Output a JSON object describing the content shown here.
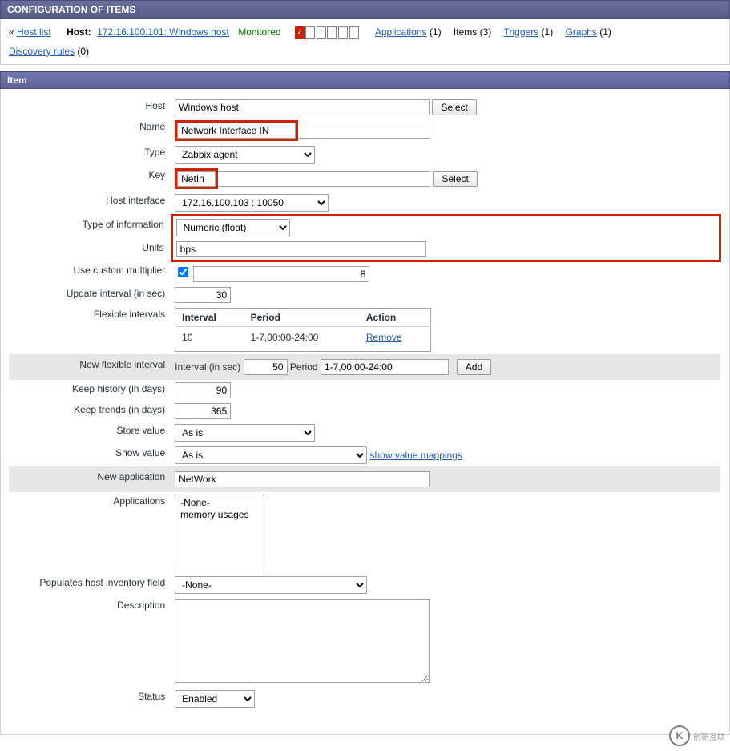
{
  "header": {
    "title": "CONFIGURATION OF ITEMS"
  },
  "nav": {
    "back_arrow": "«",
    "host_list": "Host list",
    "host_label": "Host:",
    "host_link": "172.16.100.101: Windows host",
    "monitored": "Monitored",
    "tags_letters": [
      "Z",
      "",
      "",
      "",
      "",
      ""
    ],
    "applications": {
      "label": "Applications",
      "count": "(1)"
    },
    "items": {
      "label": "Items",
      "count": "(3)"
    },
    "triggers": {
      "label": "Triggers",
      "count": "(1)"
    },
    "graphs": {
      "label": "Graphs",
      "count": "(1)"
    },
    "discovery": {
      "label": "Discovery rules",
      "count": "(0)"
    }
  },
  "section": {
    "title": "Item"
  },
  "form": {
    "labels": {
      "host": "Host",
      "name": "Name",
      "type": "Type",
      "key": "Key",
      "host_interface": "Host interface",
      "type_of_information": "Type of information",
      "units": "Units",
      "use_custom_multiplier": "Use custom multiplier",
      "update_interval": "Update interval (in sec)",
      "flexible_intervals": "Flexible intervals",
      "new_flexible_interval": "New flexible interval",
      "keep_history": "Keep history (in days)",
      "keep_trends": "Keep trends (in days)",
      "store_value": "Store value",
      "show_value": "Show value",
      "new_application": "New application",
      "applications": "Applications",
      "populates_inventory": "Populates host inventory field",
      "description": "Description",
      "status": "Status"
    },
    "values": {
      "host": "Windows host",
      "name": "Network Interface IN",
      "type": "Zabbix agent",
      "key": "NetIn",
      "host_interface": "172.16.100.103 : 10050",
      "type_of_information": "Numeric (float)",
      "units": "bps",
      "use_custom_multiplier_checked": true,
      "multiplier_value": "8",
      "update_interval": "30",
      "keep_history": "90",
      "keep_trends": "365",
      "store_value": "As is",
      "show_value": "As is",
      "new_application": "NetWork",
      "applications_options": [
        "-None-",
        "memory usages"
      ],
      "populates_inventory": "-None-",
      "description": "",
      "status": "Enabled"
    },
    "flex_table": {
      "headers": {
        "interval": "Interval",
        "period": "Period",
        "action": "Action"
      },
      "rows": [
        {
          "interval": "10",
          "period": "1-7,00:00-24:00",
          "action": "Remove"
        }
      ]
    },
    "nfi": {
      "interval_label": "Interval (in sec)",
      "interval_value": "50",
      "period_label": "Period",
      "period_value": "1-7,00:00-24:00",
      "add": "Add"
    },
    "buttons": {
      "select": "Select"
    },
    "links": {
      "show_value_mappings": "show value mappings"
    }
  },
  "watermark": {
    "text": "创新互联"
  }
}
